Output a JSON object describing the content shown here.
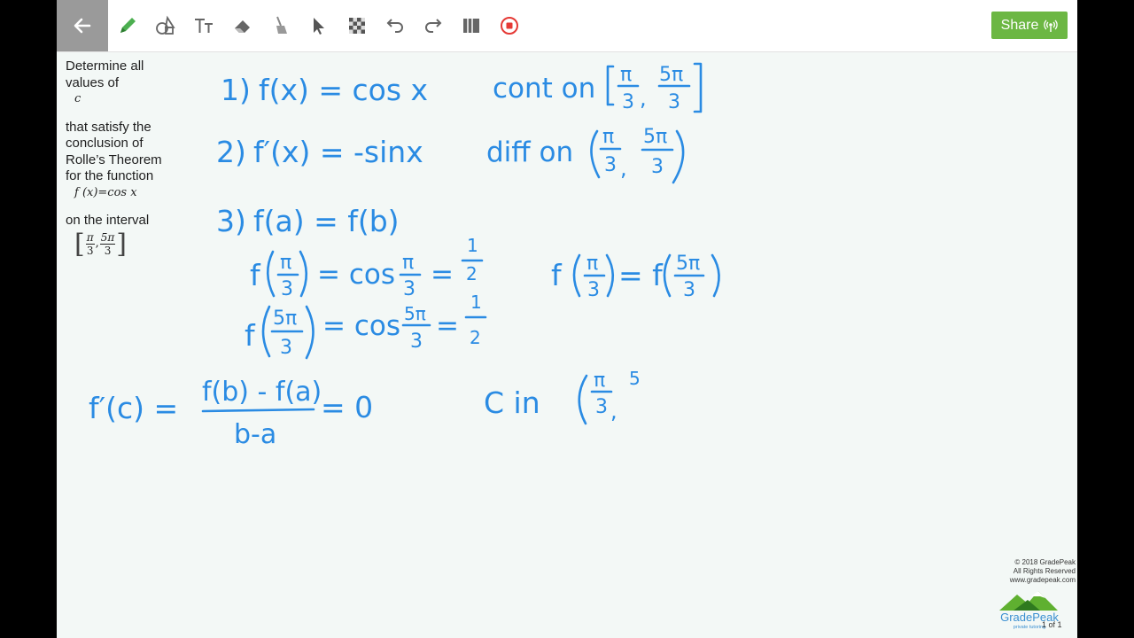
{
  "toolbar": {
    "back_icon": "arrow-left-icon",
    "tools": [
      "pencil-icon",
      "shapes-icon",
      "text-icon",
      "eraser-icon",
      "broom-icon",
      "pointer-icon",
      "checkerboard-icon",
      "undo-icon",
      "redo-icon",
      "panels-icon",
      "record-stop-icon"
    ],
    "share_label": "Share",
    "share_icon": "broadcast-icon",
    "accent_color": "#6cb743",
    "active_tool_color": "#4caf50"
  },
  "problem": {
    "line1": "Determine all",
    "line2": "values of",
    "var_c": "c",
    "line3": "that satisfy the",
    "line4": "conclusion of",
    "line5": "Rolle’s Theorem",
    "line6": "for the function",
    "function": "f (x)=cos x",
    "line7": "on the interval",
    "interval": {
      "left_num": "π",
      "left_den": "3",
      "sep": ",",
      "right_num": "5π",
      "right_den": "3"
    }
  },
  "notes": {
    "ink_color": "#2a8be3",
    "step1": {
      "label": "1)",
      "expr": "f(x) = cos x",
      "cond": "cont on"
    },
    "step2": {
      "label": "2)",
      "expr": "f′(x) = -sinx",
      "cond": "diff on"
    },
    "step3": {
      "label": "3)",
      "expr": "f(a) = f(b)"
    },
    "eval1": {
      "left": "f",
      "rhs": "= cos",
      "result": "=",
      "half_num": "1",
      "half_den": "2"
    },
    "eval2": {
      "left": "f",
      "rhs": "= cos",
      "result": "=",
      "half_num": "1",
      "half_den": "2"
    },
    "equal": {
      "left": "f",
      "mid": "= f"
    },
    "fracs": {
      "pi": "π",
      "five_pi": "5π",
      "three": "3"
    },
    "mvt": {
      "lhs": "f′(c) =",
      "num": "f(b) - f(a)",
      "den": "b-a",
      "rhs": "= 0"
    },
    "c_in": {
      "text": "C  in",
      "trail": "5"
    }
  },
  "footer": {
    "line1": "© 2018 GradePeak",
    "line2": "All Rights Reserved",
    "line3": "www.gradepeak.com",
    "logo_text": "GradePeak",
    "logo_sub": "private tutoring",
    "page": "1 of 1"
  }
}
